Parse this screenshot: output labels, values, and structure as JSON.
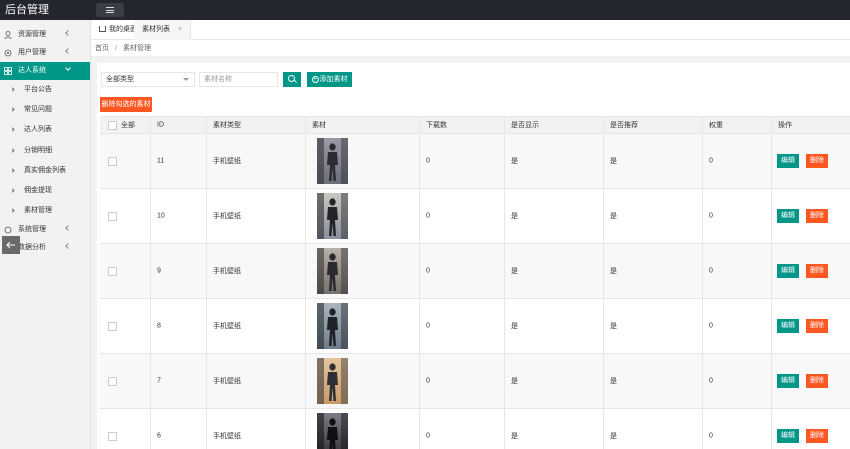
{
  "app": {
    "title": "后台管理"
  },
  "sidebar": {
    "items": [
      {
        "label": "资源管理",
        "icon": "user-icon"
      },
      {
        "label": "用户管理",
        "icon": "settings-icon"
      },
      {
        "label": "达人系统",
        "icon": "grid-icon",
        "active": true
      },
      {
        "label": "系统管理",
        "icon": "settings-icon"
      },
      {
        "label": "数据分析",
        "icon": "chart-icon"
      }
    ],
    "sub_items": [
      "平台公告",
      "常见问题",
      "达人列表",
      "分销明细",
      "真实佣金列表",
      "佣金提现",
      "素材管理"
    ]
  },
  "tabs": [
    {
      "label": "我的桌面"
    },
    {
      "label": "素材列表",
      "active": true
    }
  ],
  "breadcrumb": {
    "home": "首页",
    "sep": "/",
    "current": "素材管理"
  },
  "toolbar": {
    "type_select": "全部类型",
    "search_placeholder": "素材名称",
    "add_label": "添加素材",
    "delete_selected_label": "删除勾选的素材"
  },
  "table": {
    "headers": [
      "全部",
      "ID",
      "素材类型",
      "素材",
      "下载数",
      "是否显示",
      "是否推荐",
      "权重",
      "操作"
    ],
    "edit_label": "编辑",
    "delete_label": "删除",
    "rows": [
      {
        "id": "11",
        "type": "手机壁纸",
        "downloads": "0",
        "show": "是",
        "recommend": "是",
        "weight": "0"
      },
      {
        "id": "10",
        "type": "手机壁纸",
        "downloads": "0",
        "show": "是",
        "recommend": "是",
        "weight": "0"
      },
      {
        "id": "9",
        "type": "手机壁纸",
        "downloads": "0",
        "show": "是",
        "recommend": "是",
        "weight": "0"
      },
      {
        "id": "8",
        "type": "手机壁纸",
        "downloads": "0",
        "show": "是",
        "recommend": "是",
        "weight": "0"
      },
      {
        "id": "7",
        "type": "手机壁纸",
        "downloads": "0",
        "show": "是",
        "recommend": "是",
        "weight": "0"
      },
      {
        "id": "6",
        "type": "手机壁纸",
        "downloads": "0",
        "show": "是",
        "recommend": "是",
        "weight": "0"
      }
    ]
  },
  "colors": {
    "primary": "#009688",
    "danger": "#ff5722",
    "topbar": "#23262e"
  }
}
